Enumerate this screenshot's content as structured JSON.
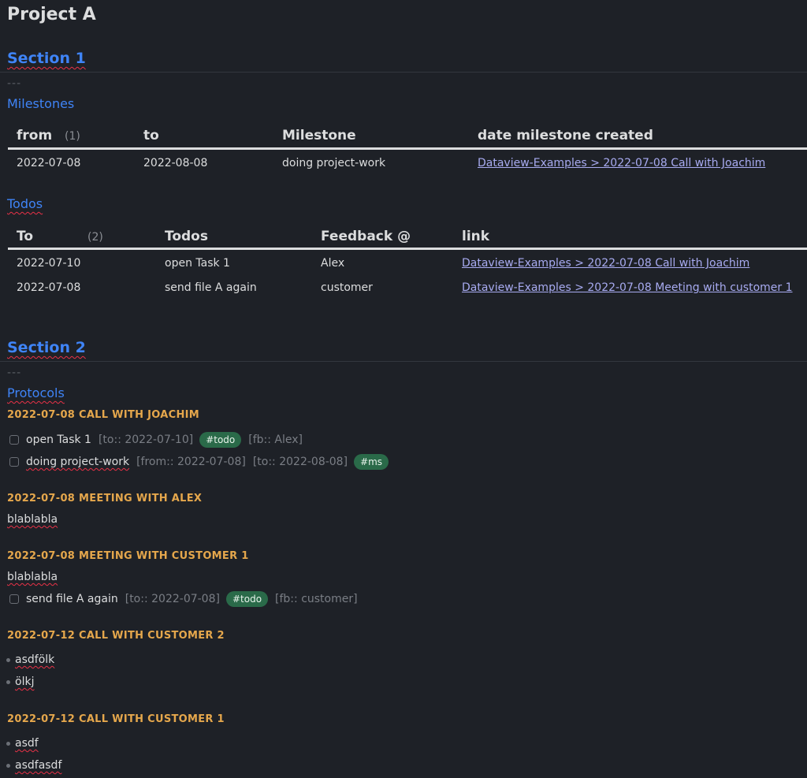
{
  "page_title": "Project A",
  "section1": {
    "heading": "Section 1",
    "dashes": "---",
    "milestones": {
      "heading": "Milestones",
      "columns": [
        "from",
        "to",
        "Milestone",
        "date milestone created"
      ],
      "count": "(1)",
      "rows": [
        {
          "from": "2022-07-08",
          "to": "2022-08-08",
          "milestone": "doing project-work",
          "created": "Dataview-Examples > 2022-07-08 Call with Joachim"
        }
      ]
    },
    "todos": {
      "heading": "Todos",
      "columns": [
        "To",
        "Todos",
        "Feedback @",
        "link"
      ],
      "count": "(2)",
      "rows": [
        {
          "to": "2022-07-10",
          "todo": "open Task 1",
          "feedback": "Alex",
          "link": "Dataview-Examples > 2022-07-08 Call with Joachim"
        },
        {
          "to": "2022-07-08",
          "todo": "send file A again",
          "feedback": "customer",
          "link": "Dataview-Examples > 2022-07-08 Meeting with customer 1"
        }
      ]
    }
  },
  "section2": {
    "heading": "Section 2",
    "dashes": "---",
    "protocols": {
      "heading": "Protocols",
      "call_joachim": {
        "heading": "2022-07-08 CALL WITH JOACHIM",
        "tasks": [
          {
            "text": "open Task 1",
            "meta1": "[to:: 2022-07-10]",
            "tag": "#todo",
            "meta2": "[fb:: Alex]"
          },
          {
            "text": "doing project-work",
            "meta1": "[from:: 2022-07-08]",
            "meta2": "[to:: 2022-08-08]",
            "tag": "#ms"
          }
        ]
      },
      "meeting_alex": {
        "heading": "2022-07-08 MEETING WITH ALEX",
        "body": "blablabla"
      },
      "meeting_customer1": {
        "heading": "2022-07-08 MEETING WITH CUSTOMER 1",
        "body": "blablabla",
        "task": {
          "text": "send file A again",
          "meta1": "[to:: 2022-07-08]",
          "tag": "#todo",
          "meta2": "[fb:: customer]"
        }
      },
      "call_customer2": {
        "heading": "2022-07-12 CALL WITH CUSTOMER 2",
        "bullets": [
          "asdfölk",
          "ölkj"
        ]
      },
      "call_customer1": {
        "heading": "2022-07-12 CALL WITH CUSTOMER 1",
        "bullets": [
          "asdf",
          "asdfasdf"
        ]
      }
    }
  }
}
